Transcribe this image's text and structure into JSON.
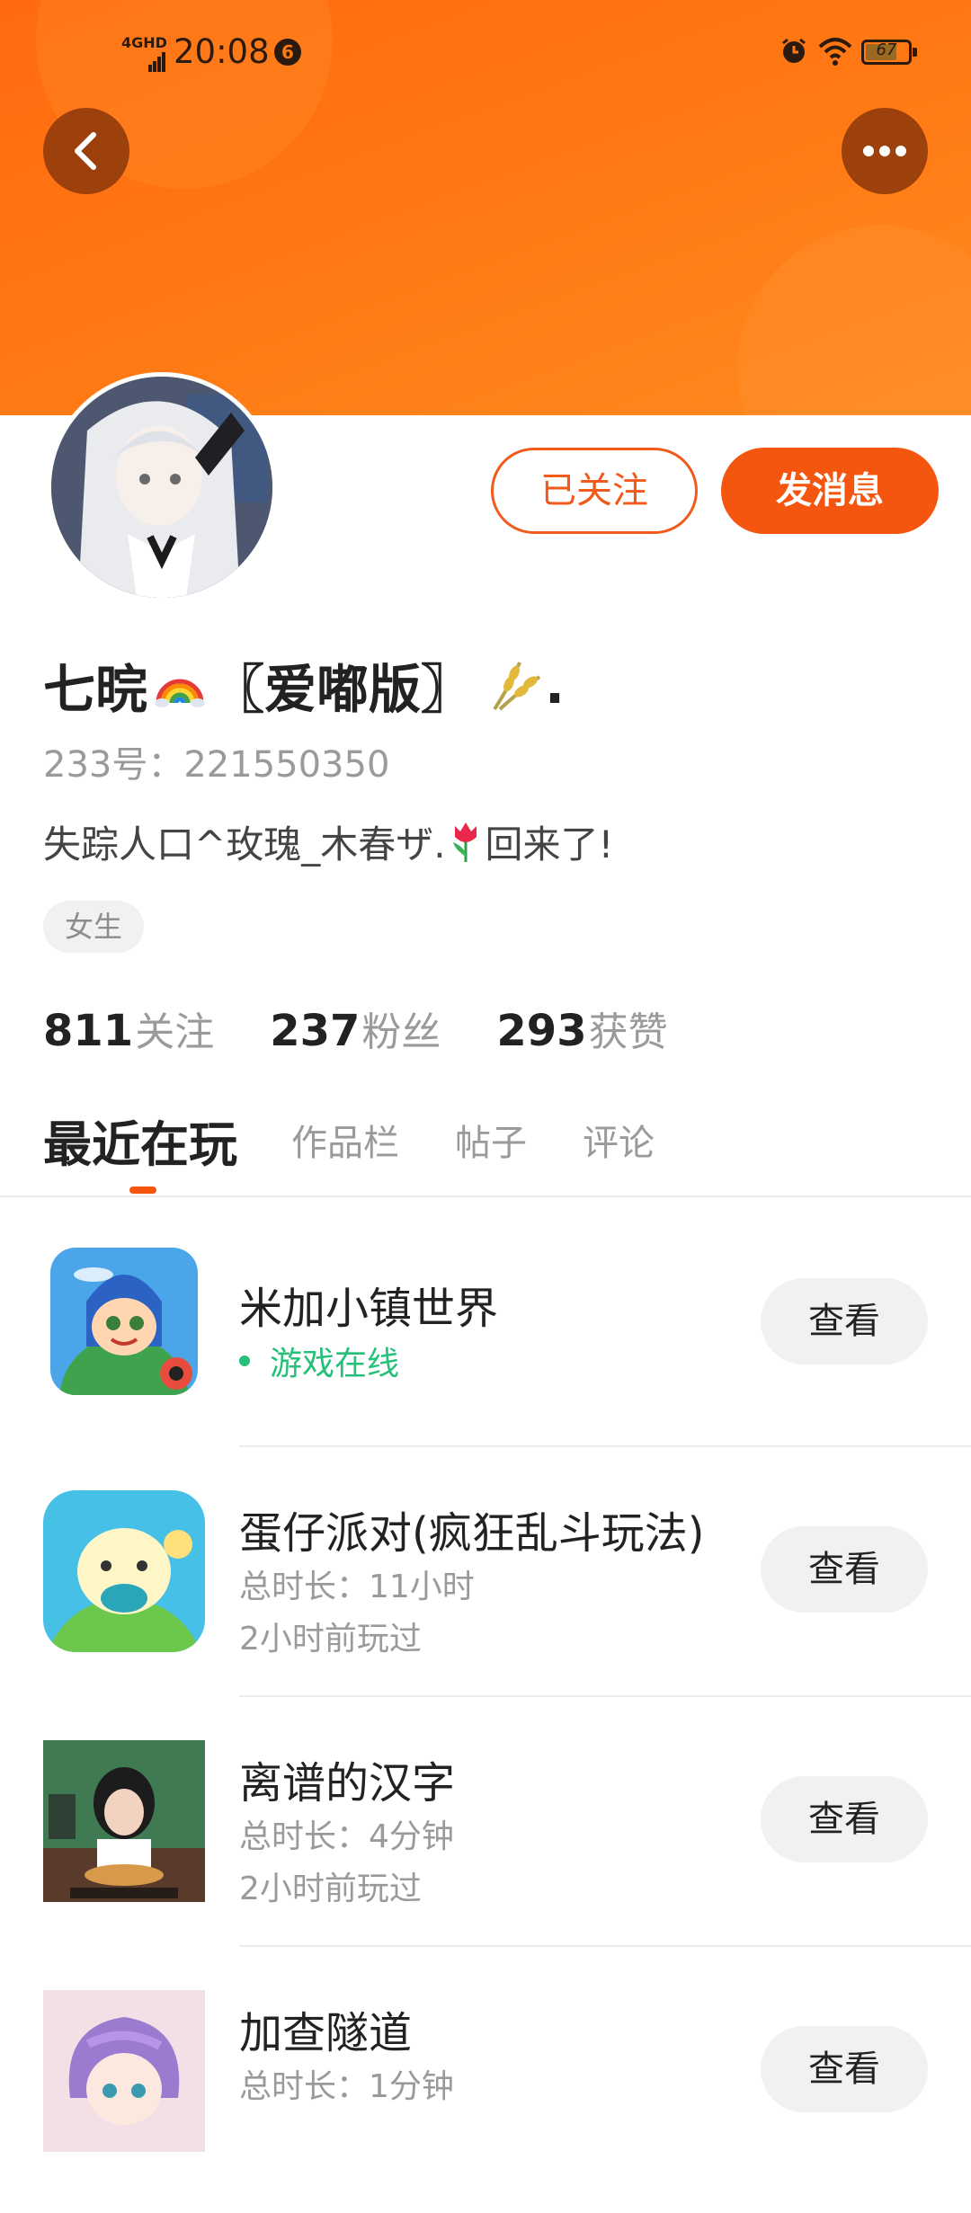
{
  "status_bar": {
    "network": "4GHD",
    "time": "20:08",
    "notification_count": "6",
    "battery": "67"
  },
  "header": {
    "back_icon": "chevron-left-icon",
    "more_icon": "more-dots-icon"
  },
  "profile": {
    "name_main": "七晥",
    "name_bracket": "〖爱嘟版〗",
    "name_tail": ".",
    "id_text": "233号：221550350",
    "bio_before": "失踪人口^玫瑰_木春ザ.",
    "bio_after": "回来了!",
    "gender_tag": "女生",
    "follow_button": "已关注",
    "message_button": "发消息"
  },
  "stats": [
    {
      "value": "811",
      "label": "关注"
    },
    {
      "value": "237",
      "label": "粉丝"
    },
    {
      "value": "293",
      "label": "获赞"
    }
  ],
  "tabs": [
    "最近在玩",
    "作品栏",
    "帖子",
    "评论"
  ],
  "games": [
    {
      "title": "米加小镇世界",
      "status": "游戏在线",
      "button": "查看"
    },
    {
      "title": "蛋仔派对(疯狂乱斗玩法)",
      "duration": "总时长：11小时",
      "last_played": "2小时前玩过",
      "button": "查看"
    },
    {
      "title": "离谱的汉字",
      "duration": "总时长：4分钟",
      "last_played": "2小时前玩过",
      "button": "查看"
    },
    {
      "title": "加查隧道",
      "duration": "总时长：1分钟",
      "button": "查看"
    }
  ],
  "colors": {
    "accent": "#f5560f",
    "header": "#ff7a14",
    "online": "#26c07a"
  }
}
